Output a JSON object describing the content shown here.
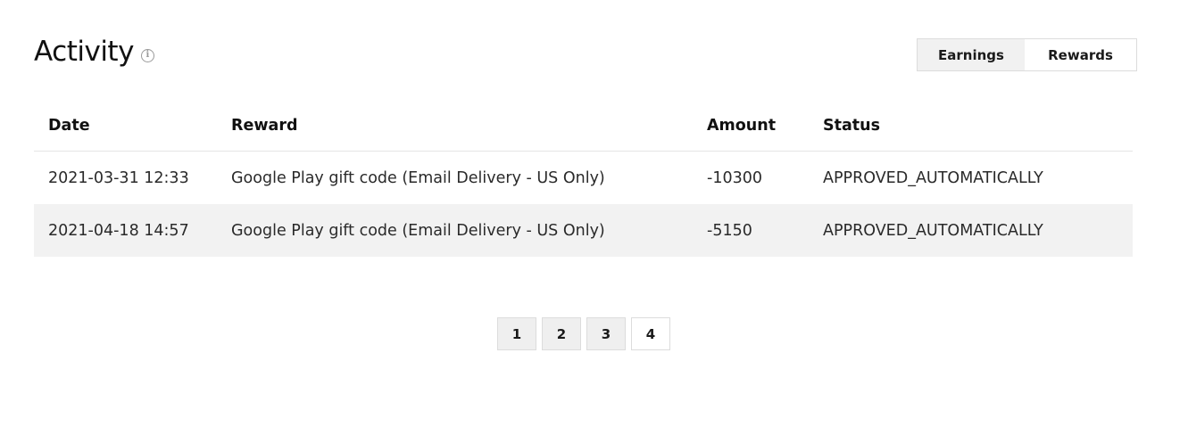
{
  "header": {
    "title": "Activity",
    "info_icon": "info-icon"
  },
  "toggle": {
    "earnings_label": "Earnings",
    "rewards_label": "Rewards",
    "selected": "Rewards"
  },
  "table": {
    "columns": [
      "Date",
      "Reward",
      "Amount",
      "Status"
    ],
    "rows": [
      {
        "date": "2021-03-31 12:33",
        "reward": "Google Play gift code (Email Delivery - US Only)",
        "amount": "-10300",
        "status": "APPROVED_AUTOMATICALLY"
      },
      {
        "date": "2021-04-18 14:57",
        "reward": "Google Play gift code (Email Delivery - US Only)",
        "amount": "-5150",
        "status": "APPROVED_AUTOMATICALLY"
      }
    ]
  },
  "pagination": {
    "pages": [
      "1",
      "2",
      "3",
      "4"
    ],
    "current": "4"
  }
}
